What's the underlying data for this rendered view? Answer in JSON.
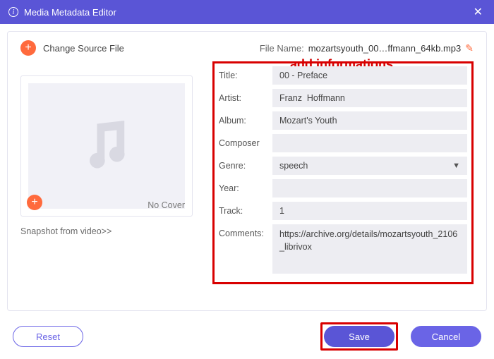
{
  "titlebar": {
    "title": "Media Metadata Editor"
  },
  "top": {
    "change_source": "Change Source File",
    "file_name_label": "File Name:",
    "file_name_value": "mozartsyouth_00…ffmann_64kb.mp3"
  },
  "annotation": "add informations",
  "cover": {
    "no_cover": "No Cover",
    "snapshot": "Snapshot from video>>"
  },
  "fields": {
    "title_label": "Title:",
    "title_value": "00 - Preface",
    "artist_label": "Artist:",
    "artist_value": "Franz  Hoffmann",
    "album_label": "Album:",
    "album_value": "Mozart's Youth",
    "composer_label": "Composer",
    "composer_value": "",
    "genre_label": "Genre:",
    "genre_value": "speech",
    "year_label": "Year:",
    "year_value": "",
    "track_label": "Track:",
    "track_value": "1",
    "comments_label": "Comments:",
    "comments_value": "https://archive.org/details/mozartsyouth_2106_librivox"
  },
  "footer": {
    "reset": "Reset",
    "save": "Save",
    "cancel": "Cancel"
  }
}
